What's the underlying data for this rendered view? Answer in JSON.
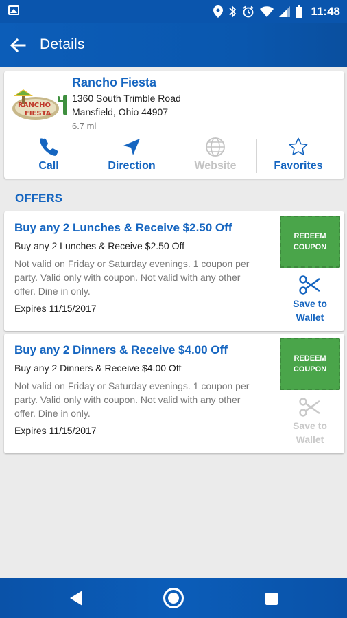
{
  "status_bar": {
    "time": "11:48",
    "icons": [
      "gallery-icon",
      "location-icon",
      "bluetooth-icon",
      "alarm-icon",
      "wifi-icon",
      "signal-icon",
      "battery-icon"
    ]
  },
  "app_bar": {
    "title": "Details",
    "back_icon": "arrow-left-icon"
  },
  "business": {
    "name": "Rancho Fiesta",
    "address_line1": "1360 South Trimble Road",
    "address_line2": "Mansfield, Ohio 44907",
    "distance": "6.7 ml",
    "logo_icon": "rancho-fiesta-logo"
  },
  "actions": [
    {
      "label": "Call",
      "icon": "phone-icon",
      "enabled": true
    },
    {
      "label": "Direction",
      "icon": "navigation-icon",
      "enabled": true
    },
    {
      "label": "Website",
      "icon": "globe-icon",
      "enabled": false
    },
    {
      "label": "Favorites",
      "icon": "star-outline-icon",
      "enabled": true
    }
  ],
  "offers_heading": "OFFERS",
  "offers": [
    {
      "title": "Buy any 2 Lunches & Receive $2.50 Off",
      "subtitle": "Buy any 2 Lunches & Receive $2.50 Off",
      "description": "Not valid on Friday or Saturday evenings. 1 coupon per party. Valid only with coupon. Not valid with any other offer. Dine in only.",
      "expires": "Expires 11/15/2017",
      "redeem_label": "REDEEM COUPON",
      "wallet_label_1": "Save to",
      "wallet_label_2": "Wallet",
      "wallet_enabled": true
    },
    {
      "title": "Buy any 2 Dinners & Receive $4.00 Off",
      "subtitle": "Buy any 2 Dinners & Receive $4.00 Off",
      "description": "Not valid on Friday or Saturday evenings. 1 coupon per party. Valid only with coupon. Not valid with any other offer. Dine in only.",
      "expires": "Expires 11/15/2017",
      "redeem_label": "REDEEM COUPON",
      "wallet_label_1": "Save to",
      "wallet_label_2": "Wallet",
      "wallet_enabled": false
    }
  ],
  "nav_bar": {
    "icons": [
      "back-triangle-icon",
      "home-circle-icon",
      "recents-square-icon"
    ]
  },
  "colors": {
    "primary": "#0a57ae",
    "accent_text": "#1565c0",
    "redeem_green": "#4aa54a",
    "disabled": "#c4c4c4",
    "background": "#ebebeb"
  }
}
